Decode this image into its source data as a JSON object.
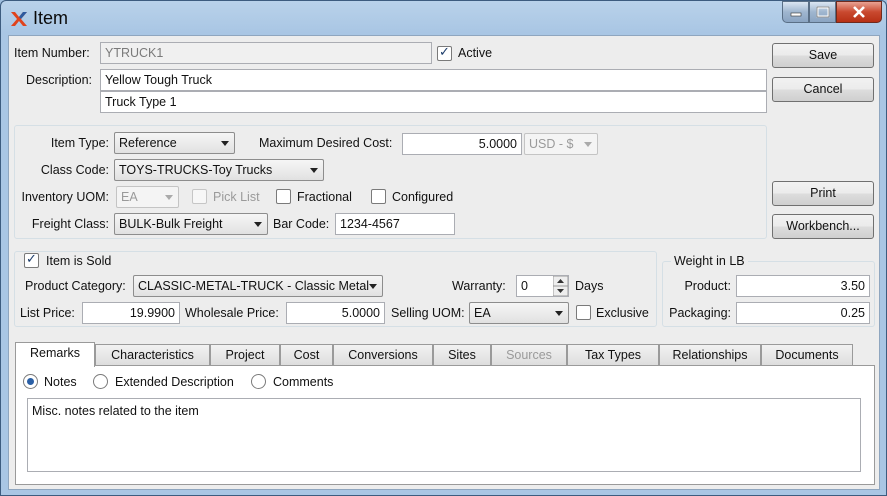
{
  "window": {
    "title": "Item"
  },
  "header": {
    "item_number_label": "Item Number:",
    "item_number_value": "YTRUCK1",
    "active_label": "Active",
    "active_checked": true,
    "description_label": "Description:",
    "description1": "Yellow Tough Truck",
    "description2": "Truck Type 1"
  },
  "buttons": {
    "save": "Save",
    "cancel": "Cancel",
    "print": "Print",
    "workbench": "Workbench..."
  },
  "details": {
    "item_type_label": "Item Type:",
    "item_type_value": "Reference",
    "max_cost_label": "Maximum Desired Cost:",
    "max_cost_value": "5.0000",
    "currency_value": "USD - $",
    "class_code_label": "Class Code:",
    "class_code_value": "TOYS-TRUCKS-Toy Trucks",
    "inventory_uom_label": "Inventory UOM:",
    "inventory_uom_value": "EA",
    "pick_list_label": "Pick List",
    "fractional_label": "Fractional",
    "configured_label": "Configured",
    "freight_class_label": "Freight Class:",
    "freight_class_value": "BULK-Bulk Freight",
    "bar_code_label": "Bar Code:",
    "bar_code_value": "1234-4567"
  },
  "sold": {
    "item_is_sold_label": "Item is Sold",
    "item_is_sold_checked": true,
    "product_category_label": "Product Category:",
    "product_category_value": "CLASSIC-METAL-TRUCK - Classic Metal",
    "warranty_label": "Warranty:",
    "warranty_value": "0",
    "days_label": "Days",
    "list_price_label": "List Price:",
    "list_price_value": "19.9900",
    "wholesale_price_label": "Wholesale Price:",
    "wholesale_price_value": "5.0000",
    "selling_uom_label": "Selling UOM:",
    "selling_uom_value": "EA",
    "exclusive_label": "Exclusive"
  },
  "weight": {
    "title": "Weight in LB",
    "product_label": "Product:",
    "product_value": "3.50",
    "packaging_label": "Packaging:",
    "packaging_value": "0.25"
  },
  "tabs": [
    {
      "label": "Remarks"
    },
    {
      "label": "Characteristics"
    },
    {
      "label": "Project"
    },
    {
      "label": "Cost"
    },
    {
      "label": "Conversions"
    },
    {
      "label": "Sites"
    },
    {
      "label": "Sources"
    },
    {
      "label": "Tax Types"
    },
    {
      "label": "Relationships"
    },
    {
      "label": "Documents"
    }
  ],
  "remarks": {
    "notes_label": "Notes",
    "extended_label": "Extended Description",
    "comments_label": "Comments",
    "notes_text": "Misc. notes related to the item"
  }
}
